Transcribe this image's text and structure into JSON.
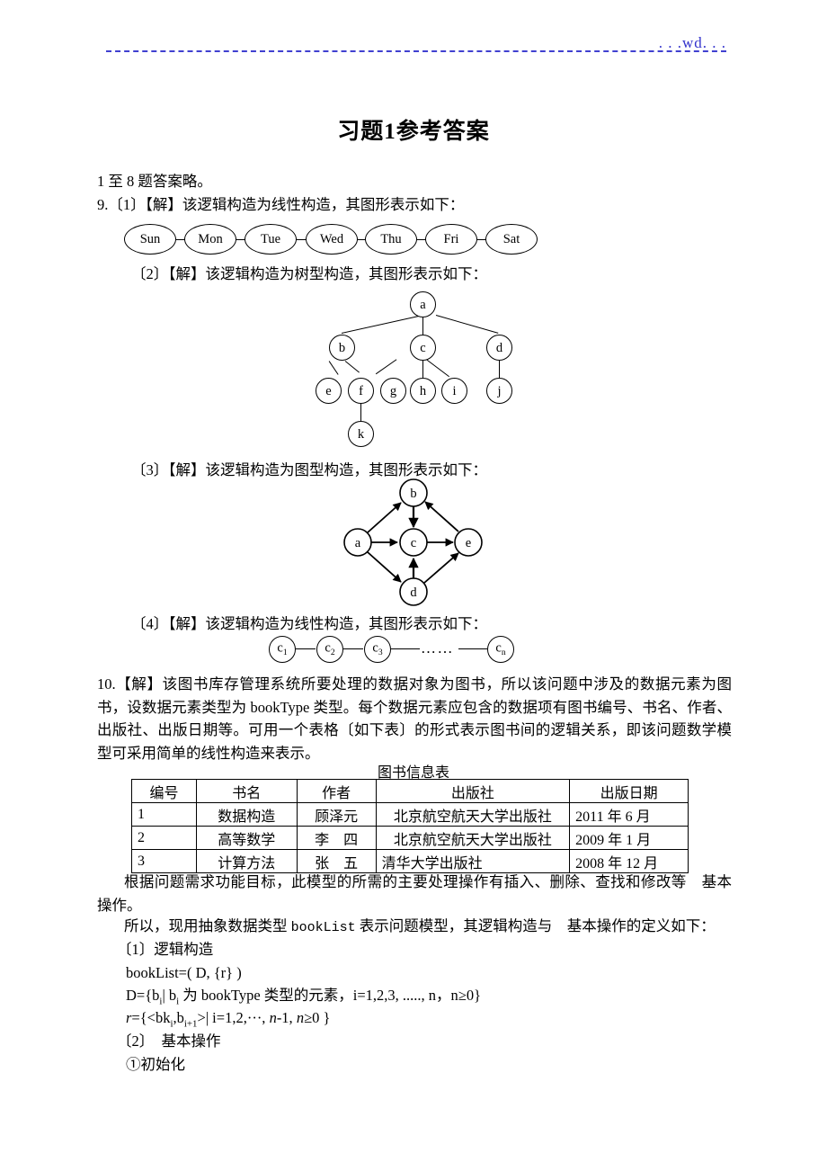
{
  "header": {
    "watermark": ". . .wd. . ."
  },
  "title": "习题1参考答案",
  "intro_line": "1 至 8 题答案略。",
  "items": {
    "q9_1": "9.〔1〕【解】该逻辑构造为线性构造，其图形表示如下：",
    "q9_2": "〔2〕【解】该逻辑构造为树型构造，其图形表示如下：",
    "q9_3": "〔3〕【解】该逻辑构造为图型构造，其图形表示如下：",
    "q9_4": "〔4〕【解】该逻辑构造为线性构造，其图形表示如下："
  },
  "diagrams": {
    "week_chain": {
      "nodes": [
        "Sun",
        "Mon",
        "Tue",
        "Wed",
        "Thu",
        "Fri",
        "Sat"
      ]
    },
    "tree": {
      "root": "a",
      "nodes": [
        "a",
        "b",
        "c",
        "d",
        "e",
        "f",
        "g",
        "h",
        "i",
        "j",
        "k"
      ],
      "edges": [
        [
          "a",
          "b"
        ],
        [
          "a",
          "c"
        ],
        [
          "a",
          "d"
        ],
        [
          "b",
          "e"
        ],
        [
          "b",
          "f"
        ],
        [
          "f",
          "k"
        ],
        [
          "c",
          "g"
        ],
        [
          "c",
          "h"
        ],
        [
          "c",
          "i"
        ],
        [
          "d",
          "j"
        ]
      ]
    },
    "graph": {
      "nodes": [
        "a",
        "b",
        "c",
        "d",
        "e"
      ],
      "directed_edges": [
        [
          "a",
          "b"
        ],
        [
          "a",
          "c"
        ],
        [
          "a",
          "d"
        ],
        [
          "b",
          "c"
        ],
        [
          "c",
          "e"
        ],
        [
          "d",
          "c"
        ],
        [
          "d",
          "e"
        ],
        [
          "e",
          "b"
        ]
      ]
    },
    "c_chain": {
      "nodes": [
        "c1",
        "c2",
        "c3",
        "cn"
      ],
      "labels": [
        "c",
        "c",
        "c",
        "c"
      ],
      "subscripts": [
        "1",
        "2",
        "3",
        "n"
      ],
      "ellipsis": "……"
    }
  },
  "paragraph10": "10.【解】该图书库存管理系统所要处理的数据对象为图书，所以该问题中涉及的数据元素为图书，设数据元素类型为 bookType 类型。每个数据元素应包含的数据项有图书编号、书名、作者、出版社、出版日期等。可用一个表格〔如下表〕的形式表示图书间的逻辑关系，即该问题数学模型可采用简单的线性构造来表示。",
  "table": {
    "caption": "图书信息表",
    "columns": [
      "编号",
      "书名",
      "作者",
      "出版社",
      "出版日期"
    ],
    "rows": [
      {
        "id": "1",
        "name": "数据构造",
        "author": "顾泽元",
        "publisher": "北京航空航天大学出版社",
        "date": "2011 年 6 月"
      },
      {
        "id": "2",
        "name": "高等数学",
        "author": "李　四",
        "publisher": "北京航空航天大学出版社",
        "date": "2009 年 1 月"
      },
      {
        "id": "3",
        "name": "计算方法",
        "author": "张　五",
        "publisher": "清华大学出版社",
        "date": "2008 年 12 月"
      }
    ]
  },
  "closing": {
    "p1": "根据问题需求功能目标，此模型的所需的主要处理操作有插入、删除、查找和修改等　基本操作。",
    "p2_pre": "所以，现用抽象数据类型 ",
    "p2_mono": "bookList",
    "p2_post": " 表示问题模型，其逻辑构造与　基本操作的定义如下：",
    "s1": "〔1〕逻辑构造",
    "f1": "bookList=( D, {r} )",
    "f2_a": "D={b",
    "f2_b": "| b",
    "f2_c": " 为 bookType 类型的元素，i=1,2,3, ....., n，n≥0}",
    "f3_a": "r",
    "f3_b": "={<bk",
    "f3_c": ",b",
    "f3_d": ">| i=1,2,···, ",
    "f3_e": "n",
    "f3_f": "-1, ",
    "f3_g": "n",
    "f3_h": "≥0 }",
    "s2": "〔2〕　基本操作",
    "op1": "①初始化"
  }
}
